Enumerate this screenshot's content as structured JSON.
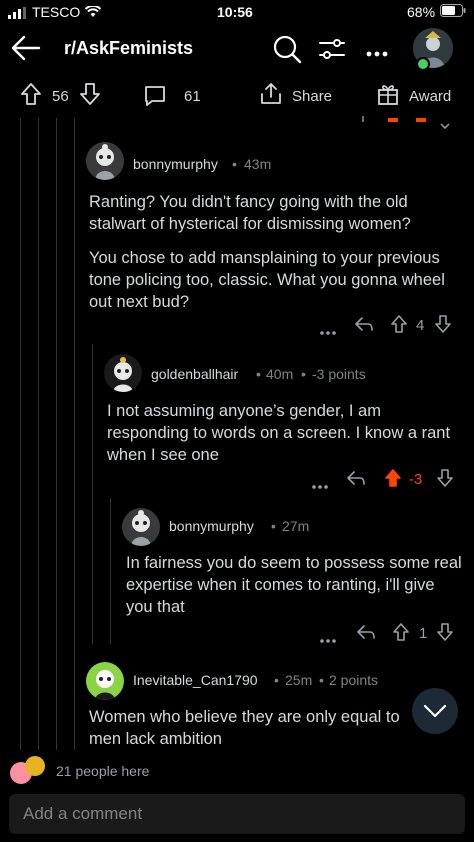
{
  "status": {
    "carrier": "TESCO",
    "time": "10:56",
    "battery": "68%"
  },
  "header": {
    "subreddit": "r/AskFeminists"
  },
  "post_actions": {
    "score": "56",
    "comments": "61",
    "share": "Share",
    "award": "Award"
  },
  "comments": [
    {
      "user": "bonnymurphy",
      "meta": "43m",
      "paragraphs": [
        "Ranting? You didn't fancy going with the old stalwart of hysterical for dismissing women?",
        "You chose to add mansplaining to your previous tone policing too, classic. What you gonna wheel out next bud?"
      ],
      "score": "4"
    },
    {
      "user": "goldenballhair",
      "meta": "40m",
      "points": "-3 points",
      "paragraphs": [
        "I not assuming anyone’s gender, I am responding to words on a screen. I know a rant when I see one"
      ],
      "score": "-3"
    },
    {
      "user": "bonnymurphy",
      "meta": "27m",
      "paragraphs": [
        "In fairness you do seem to possess some real expertise when it comes to ranting, i'll give you that"
      ],
      "score": "1"
    },
    {
      "user": "Inevitable_Can1790",
      "meta": "25m",
      "points": "2 points",
      "paragraphs": [
        "Women who believe they are only equal to men lack ambition"
      ]
    }
  ],
  "presence": {
    "text": "21 people here"
  },
  "composer": {
    "placeholder": "Add a comment"
  },
  "colors": {
    "upvote_active": "#ff4500",
    "background": "#000000",
    "presence_green": "#46d160"
  }
}
